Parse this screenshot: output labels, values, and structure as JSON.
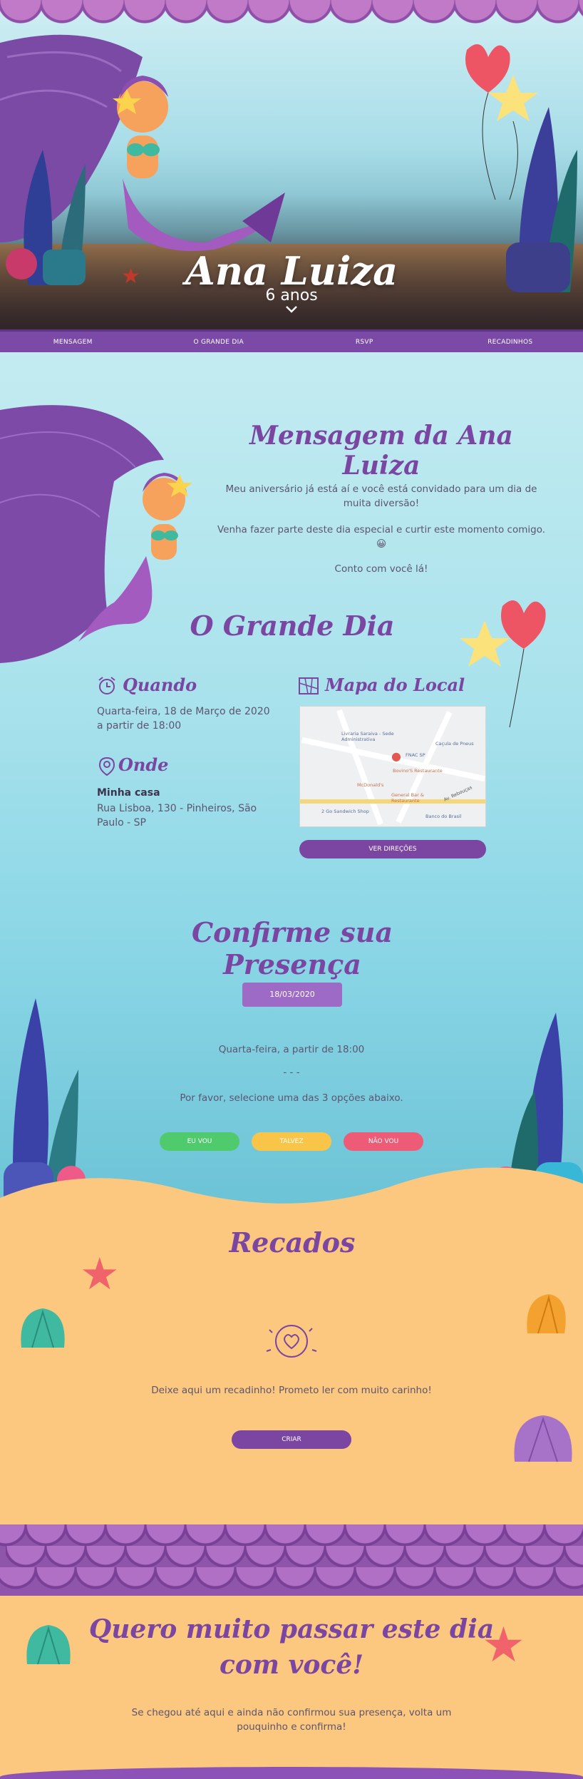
{
  "colors": {
    "purple": "#7a46a2",
    "nav": "#7a4aa6",
    "green": "#4fca6d",
    "yellow": "#f9c548",
    "red": "#ee5b76",
    "sand": "#fcc77e"
  },
  "hero": {
    "name": "Ana Luiza",
    "age": "6 anos",
    "scroll_icon": "chevron-down-icon"
  },
  "nav": {
    "items": [
      "MENSAGEM",
      "O GRANDE DIA",
      "RSVP",
      "RECADINHOS"
    ]
  },
  "mensagem": {
    "title": "Mensagem da Ana Luiza",
    "p1": "Meu aniversário já está aí e você está convidado para um dia de muita diversão!",
    "p2": "Venha fazer parte deste dia especial e curtir este momento comigo. 😀",
    "p3": "Conto com você lá!"
  },
  "grande_dia": {
    "title": "O Grande Dia",
    "quando_label": "Quando",
    "quando_date": "Quarta-feira, 18 de Março de 2020",
    "quando_time": "a partir de 18:00",
    "onde_label": "Onde",
    "onde_place": "Minha casa",
    "onde_address": "Rua Lisboa, 130 - Pinheiros, São Paulo - SP",
    "mapa_label": "Mapa do Local",
    "map_labels": [
      "Livraria Saraiva - Sede Administrativa",
      "FNAC SP",
      "Caçula de Pneus",
      "Bovino'S Restaurante",
      "McDonald's",
      "General Bar & Restaurante",
      "2 Go Sandwich Shop",
      "Banco do Brasil",
      "Av. Rebouças"
    ],
    "directions_button": "VER DIREÇÕES"
  },
  "rsvp": {
    "title": "Confirme sua Presença",
    "date_badge": "18/03/2020",
    "time_text": "Quarta-feira, a partir de 18:00",
    "dashes": "- - -",
    "prompt": "Por favor, selecione uma das 3 opções abaixo.",
    "buttons": [
      "EU VOU",
      "TALVEZ",
      "NÃO VOU"
    ]
  },
  "recados": {
    "title": "Recados",
    "text": "Deixe aqui um recadinho! Prometo ler com muito carinho!",
    "button": "CRIAR"
  },
  "final": {
    "title_line1": "Quero muito passar este dia",
    "title_line2": "com você!",
    "text": "Se chegou até aqui e ainda não confirmou sua presença, volta um pouquinho e confirma!"
  }
}
